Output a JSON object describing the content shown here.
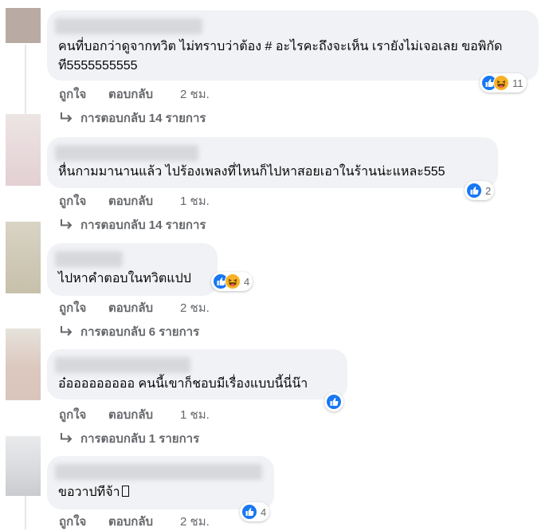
{
  "colors": {
    "like_blue": "#1877f2",
    "haha_yellow": "#f7b125",
    "bubble": "#f0f2f5",
    "meta_gray": "#65676b"
  },
  "icons": [
    "reply-arrow-icon",
    "like-reaction-icon",
    "haha-reaction-icon",
    "missing-glyph-icon"
  ],
  "comments": [
    {
      "text": "คนที่บอกว่าดูจากทวิต ไม่ทราบว่าต้อง # อะไรคะถึงจะเห็น เรายังไม่เจอเลย ขอพิกัดที5555555555",
      "reactions": [
        "like",
        "haha"
      ],
      "reaction_count": "11",
      "like_label": "ถูกใจ",
      "reply_label": "ตอบกลับ",
      "time": "2 ชม.",
      "replies_label": "การตอบกลับ 14 รายการ"
    },
    {
      "text": "หื่นกามมานานแล้ว ไปร้องเพลงที่ไหนก็ไปหาสอยเอาในร้านน่ะแหละ555",
      "reactions": [
        "like"
      ],
      "reaction_count": "2",
      "like_label": "ถูกใจ",
      "reply_label": "ตอบกลับ",
      "time": "1 ชม.",
      "replies_label": "การตอบกลับ 14 รายการ"
    },
    {
      "text": "ไปหาคำตอบในทวิตแปป",
      "reactions": [
        "like",
        "haha"
      ],
      "reaction_count": "4",
      "like_label": "ถูกใจ",
      "reply_label": "ตอบกลับ",
      "time": "2 ชม.",
      "replies_label": "การตอบกลับ 6 รายการ"
    },
    {
      "text": "อ๋อออออออออ คนนี้เขาก็ชอบมีเรื่องแบบนี้นี่น๊า",
      "reactions": [
        "like"
      ],
      "reaction_count": "",
      "like_label": "ถูกใจ",
      "reply_label": "ตอบกลับ",
      "time": "1 ชม.",
      "replies_label": "การตอบกลับ 1 รายการ"
    },
    {
      "text": "ขอวาปทีจ้า",
      "reactions": [
        "like"
      ],
      "reaction_count": "4",
      "like_label": "ถูกใจ",
      "reply_label": "ตอบกลับ",
      "time": "2 ชม.",
      "replies_label": ""
    }
  ]
}
